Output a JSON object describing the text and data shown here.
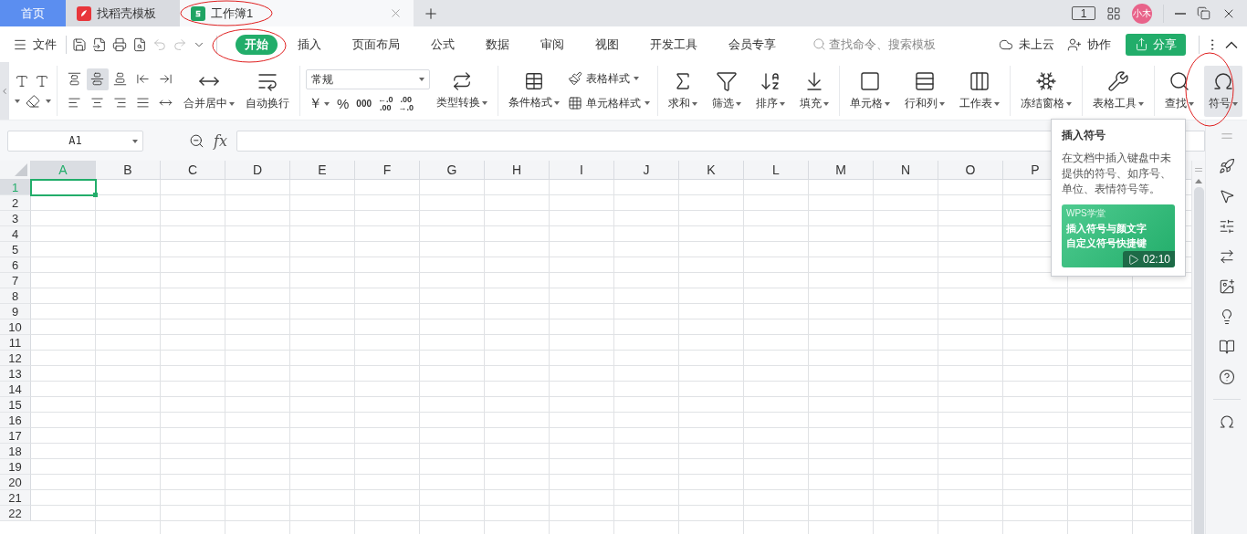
{
  "tabs": [
    {
      "label": "首页",
      "kind": "home",
      "selected": false
    },
    {
      "label": "找稻壳模板",
      "kind": "docer",
      "selected": false
    },
    {
      "label": "工作簿1",
      "kind": "sheet",
      "selected": true
    }
  ],
  "window_controls": {
    "window_count": "1",
    "avatar": "小木"
  },
  "menu": {
    "file": "文件",
    "tabs": [
      {
        "label": "开始",
        "selected": true
      },
      {
        "label": "插入",
        "selected": false
      },
      {
        "label": "页面布局",
        "selected": false
      },
      {
        "label": "公式",
        "selected": false
      },
      {
        "label": "数据",
        "selected": false
      },
      {
        "label": "审阅",
        "selected": false
      },
      {
        "label": "视图",
        "selected": false
      },
      {
        "label": "开发工具",
        "selected": false
      },
      {
        "label": "会员专享",
        "selected": false
      }
    ],
    "search": {
      "placeholder": "查找命令、搜索模板"
    },
    "cloud": "未上云",
    "collaborate": "协作",
    "share": "分享"
  },
  "ribbon": {
    "align": {
      "merge": "合并居中",
      "wrap": "自动换行"
    },
    "number": {
      "format": "常规",
      "currency": "￥",
      "percent": "%",
      "thousands": "000",
      "increase_decimal": [
        "←.0",
        ".00"
      ],
      "decrease_decimal": [
        ".00",
        "→.0"
      ],
      "convert": "类型转换"
    },
    "styles": {
      "conditional": "条件格式",
      "table_style": "表格样式",
      "cell_style": "单元格样式"
    },
    "groups": [
      [
        {
          "label": "求和",
          "highlighted": false
        },
        {
          "label": "筛选",
          "highlighted": false
        },
        {
          "label": "排序",
          "highlighted": false
        },
        {
          "label": "填充",
          "highlighted": false
        }
      ],
      [
        {
          "label": "单元格",
          "highlighted": false
        },
        {
          "label": "行和列",
          "highlighted": false
        },
        {
          "label": "工作表",
          "highlighted": false
        }
      ],
      [
        {
          "label": "冻结窗格",
          "highlighted": false
        }
      ],
      [
        {
          "label": "表格工具",
          "highlighted": false
        }
      ],
      [
        {
          "label": "查找",
          "highlighted": false
        },
        {
          "label": "符号",
          "highlighted": true
        }
      ]
    ]
  },
  "formula_bar": {
    "name_box": "A1",
    "fx": "fx"
  },
  "grid": {
    "columns": [
      {
        "label": "A",
        "selected": true
      },
      {
        "label": "B",
        "selected": false
      },
      {
        "label": "C",
        "selected": false
      },
      {
        "label": "D",
        "selected": false
      },
      {
        "label": "E",
        "selected": false
      },
      {
        "label": "F",
        "selected": false
      },
      {
        "label": "G",
        "selected": false
      },
      {
        "label": "H",
        "selected": false
      },
      {
        "label": "I",
        "selected": false
      },
      {
        "label": "J",
        "selected": false
      },
      {
        "label": "K",
        "selected": false
      },
      {
        "label": "L",
        "selected": false
      },
      {
        "label": "M",
        "selected": false
      },
      {
        "label": "N",
        "selected": false
      },
      {
        "label": "O",
        "selected": false
      },
      {
        "label": "P",
        "selected": false
      }
    ],
    "rows": [
      {
        "label": "1",
        "selected": true
      },
      {
        "label": "2",
        "selected": false
      },
      {
        "label": "3",
        "selected": false
      },
      {
        "label": "4",
        "selected": false
      },
      {
        "label": "5",
        "selected": false
      },
      {
        "label": "6",
        "selected": false
      },
      {
        "label": "7",
        "selected": false
      },
      {
        "label": "8",
        "selected": false
      },
      {
        "label": "9",
        "selected": false
      },
      {
        "label": "10",
        "selected": false
      },
      {
        "label": "11",
        "selected": false
      },
      {
        "label": "12",
        "selected": false
      },
      {
        "label": "13",
        "selected": false
      },
      {
        "label": "14",
        "selected": false
      },
      {
        "label": "15",
        "selected": false
      },
      {
        "label": "16",
        "selected": false
      },
      {
        "label": "17",
        "selected": false
      },
      {
        "label": "18",
        "selected": false
      },
      {
        "label": "19",
        "selected": false
      },
      {
        "label": "20",
        "selected": false
      },
      {
        "label": "21",
        "selected": false
      },
      {
        "label": "22",
        "selected": false
      }
    ]
  },
  "tooltip": {
    "title": "插入符号",
    "body": "在文档中插入键盘中未提供的符号、如序号、单位、表情符号等。",
    "video": {
      "brand": "WPS学堂",
      "lines": [
        "插入符号与颜文字",
        "自定义符号快捷键"
      ],
      "duration": "02:10"
    }
  }
}
